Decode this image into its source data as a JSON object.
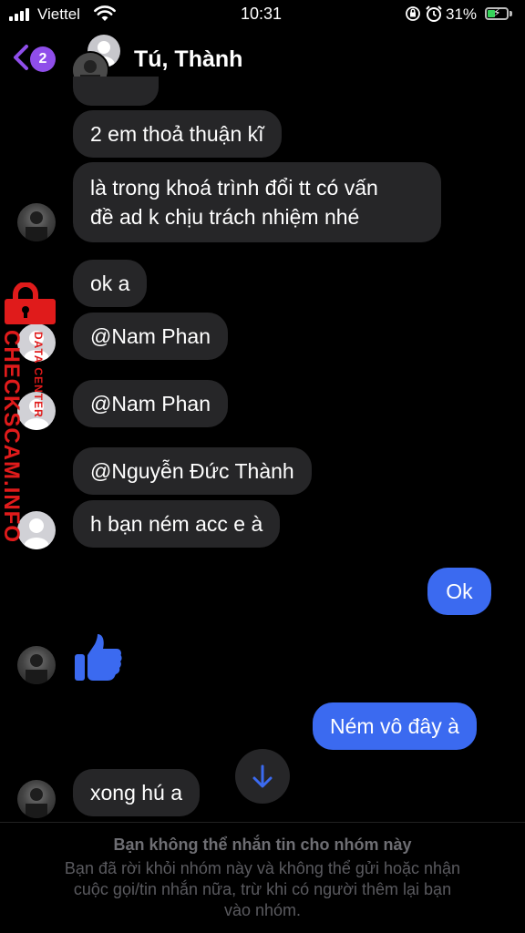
{
  "status_bar": {
    "carrier": "Viettel",
    "time": "10:31",
    "battery": "31%"
  },
  "header": {
    "back_badge": "2",
    "title": "Tú, Thành"
  },
  "messages": [
    {
      "text": "2 em thoả thuận kĩ",
      "direction": "incoming"
    },
    {
      "text": "là trong khoá trình đổi tt có vấn",
      "direction": "incoming"
    },
    {
      "text": "đề ad k chịu trách nhiệm nhé",
      "direction": "incoming"
    },
    {
      "text": "ok a",
      "direction": "incoming"
    },
    {
      "text": "@Nam Phan",
      "direction": "incoming"
    },
    {
      "text": "@Nam Phan",
      "direction": "incoming"
    },
    {
      "text": "@Nguyễn Đức Thành",
      "direction": "incoming"
    },
    {
      "text": "h bạn ném acc e à",
      "direction": "incoming"
    },
    {
      "text": "Ok",
      "direction": "outgoing"
    },
    {
      "text": "Ném vô đây à",
      "direction": "outgoing"
    },
    {
      "text": "xong hú a",
      "direction": "incoming"
    }
  ],
  "footer": {
    "title": "Bạn không thể nhắn tin cho nhóm này",
    "body_lines": [
      "Bạn đã rời khỏi nhóm này và không thể gửi hoặc nhận",
      "cuộc gọi/tin nhắn nữa, trừ khi có người thêm lại bạn",
      "vào nhóm."
    ]
  },
  "watermark": {
    "text": "CHECKSCAM.INFO",
    "sub": "DATA CENTER"
  },
  "icons": {
    "back": "chevron-left-icon",
    "like": "thumbs-up-icon",
    "scroll": "arrow-down-icon"
  },
  "colors": {
    "accent": "#3b6af0",
    "badge": "#8f4eea",
    "incoming_bubble": "#262628",
    "watermark": "#e01b1b"
  }
}
